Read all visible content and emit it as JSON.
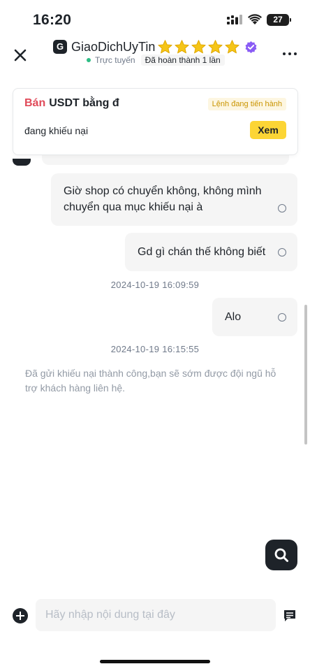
{
  "status_bar": {
    "time": "16:20",
    "battery": "27",
    "icons": [
      "signal-icon",
      "wifi-icon",
      "battery-icon"
    ]
  },
  "header": {
    "close_icon": "close-icon",
    "merchant_logo": "G",
    "merchant_name": "GiaoDichUyTin",
    "star_count": 5,
    "verified_icon": "verified-badge-icon",
    "online_status": "Trực tuyến",
    "completed_orders": "Đã hoàn thành 1 lần",
    "more_icon": "more-icon"
  },
  "order": {
    "side": "Bán",
    "asset": "USDT bằng đ",
    "status_tag": "Lệnh đang tiến hành",
    "substatus": "đang khiếu nại",
    "view_label": "Xem"
  },
  "messages": [
    {
      "type": "outgoing",
      "text": "Giờ shop có chuyển không, không mình chuyển qua mục khiếu nại à"
    },
    {
      "type": "outgoing",
      "text": "Gd gì chán thế không biết"
    },
    {
      "type": "timestamp",
      "text": "2024-10-19 16:09:59"
    },
    {
      "type": "outgoing",
      "text": "Alo"
    },
    {
      "type": "timestamp",
      "text": "2024-10-19 16:15:55"
    },
    {
      "type": "system",
      "text": "Đã gửi khiếu nại thành công,bạn sẽ sớm được đội ngũ hỗ trợ khách hàng liên hệ."
    }
  ],
  "input": {
    "placeholder": "Hãy nhập nội dung tại đây",
    "value": ""
  },
  "colors": {
    "accent": "#fcd535",
    "sell": "#e04a59",
    "online": "#2ebd85",
    "star": "#f5c518",
    "verified": "#8a5cf5"
  }
}
